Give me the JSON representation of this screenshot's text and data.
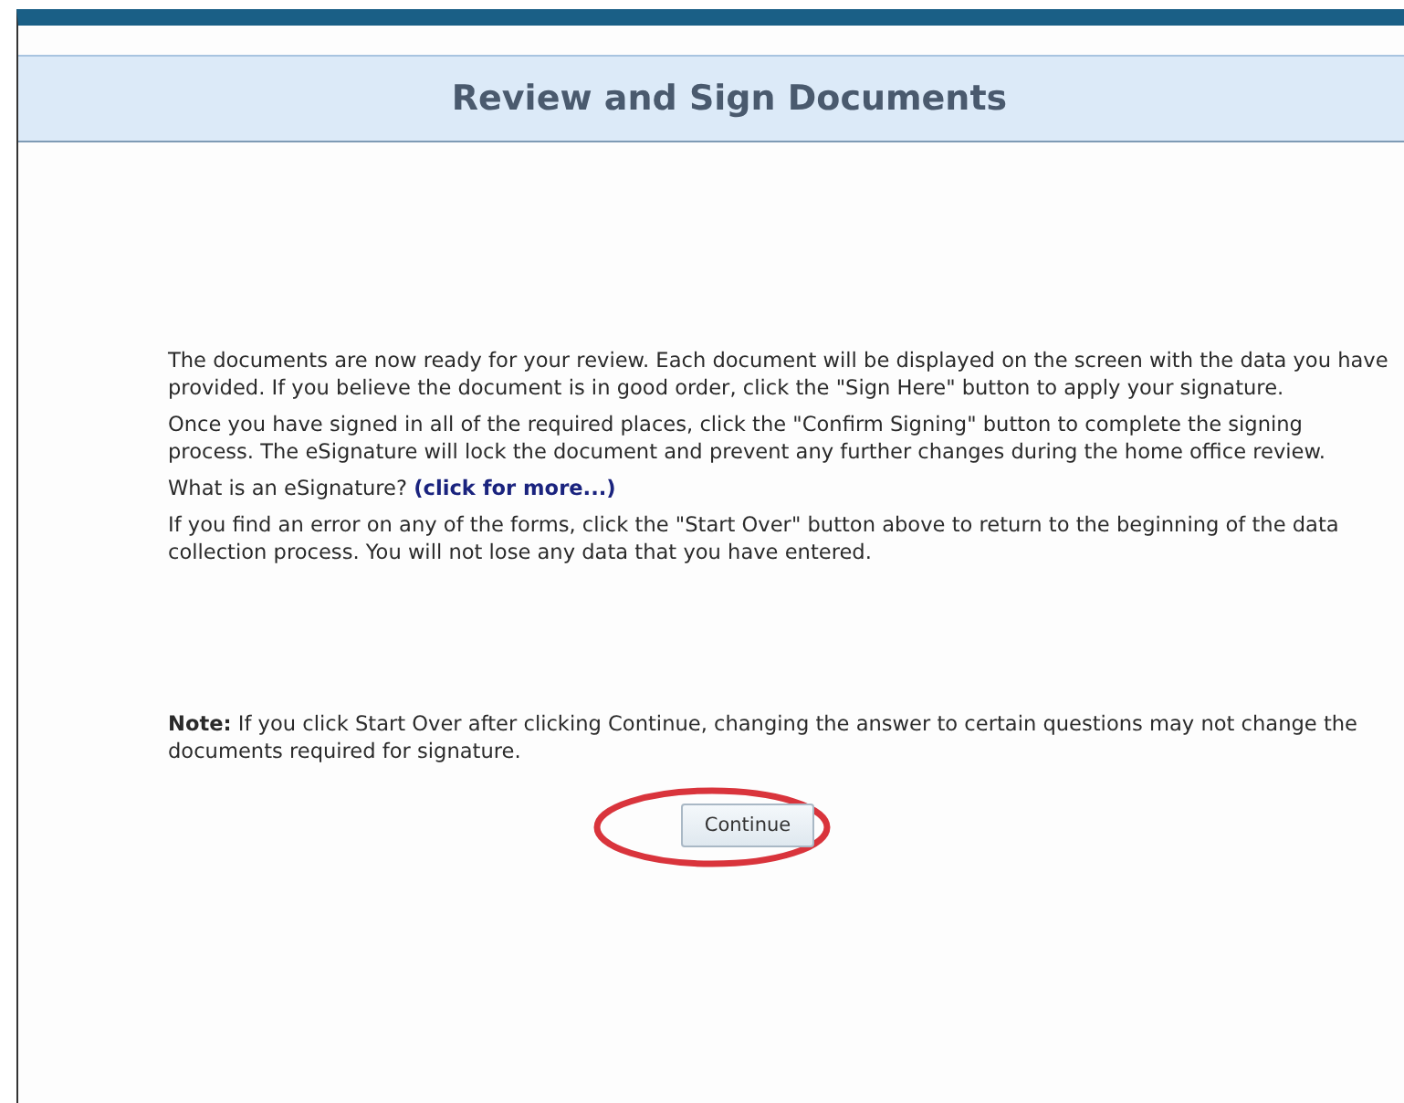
{
  "header": {
    "title": "Review and Sign Documents"
  },
  "paragraphs": [
    {
      "kind": "text",
      "text": "The documents are now ready for your review. Each document will be displayed on the screen with the data you have provided. If you believe the document is in good order, click the \"Sign Here\" button to apply your signature."
    },
    {
      "kind": "text",
      "text": "Once you have signed in all of the required places, click the \"Confirm Signing\" button to complete the signing process. The eSignature will lock the document and prevent any further changes during the home office review."
    },
    {
      "kind": "link",
      "text": "What is an eSignature?",
      "link": "(click for more...)"
    },
    {
      "kind": "text",
      "text": "If you find an error on any of the forms, click the \"Start Over\" button above to return to the beginning of the data collection process. You will not lose any data that you have entered."
    }
  ],
  "note": "**Note:** If you click Start Over after clicking Continue, changing the answer to certain questions may not change the documents required for signature.",
  "continue_button": {
    "label": "Continue",
    "highlighted": true
  }
}
